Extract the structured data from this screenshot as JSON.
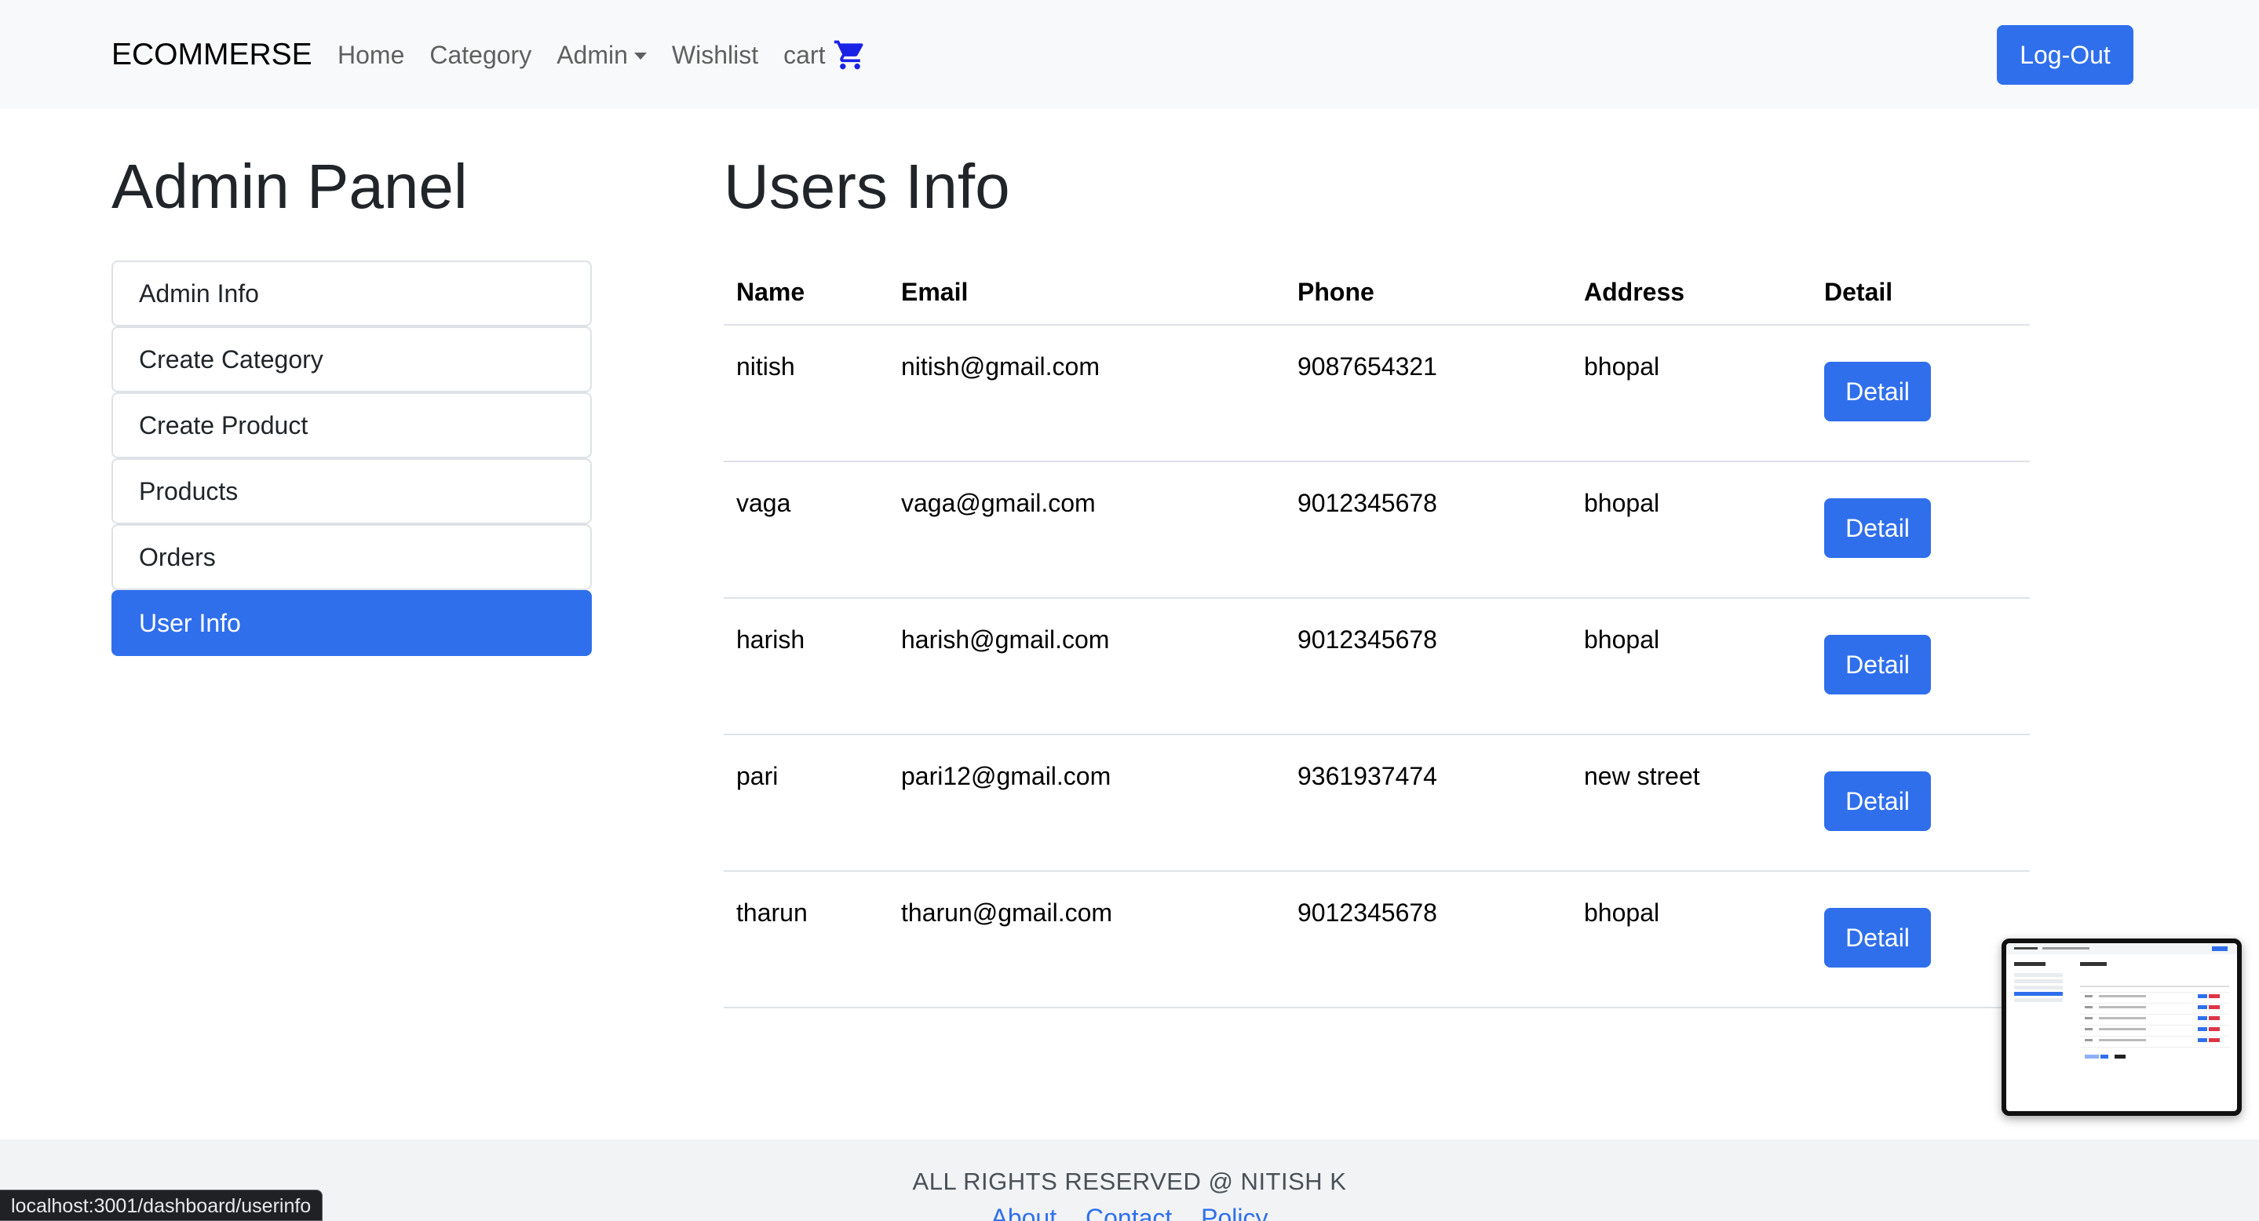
{
  "navbar": {
    "brand": "ECOMMERSE",
    "home": "Home",
    "category": "Category",
    "admin": "Admin",
    "wishlist": "Wishlist",
    "cart": "cart",
    "logout": "Log-Out",
    "accent_color": "#2f6fec"
  },
  "sidebar": {
    "title": "Admin Panel",
    "items": [
      {
        "label": "Admin Info"
      },
      {
        "label": "Create Category"
      },
      {
        "label": "Create Product"
      },
      {
        "label": "Products"
      },
      {
        "label": "Orders"
      },
      {
        "label": "User Info",
        "active": true
      }
    ]
  },
  "main": {
    "title": "Users Info",
    "columns": [
      "Name",
      "Email",
      "Phone",
      "Address",
      "Detail"
    ],
    "rows": [
      {
        "name": "nitish",
        "email": "nitish@gmail.com",
        "phone": "9087654321",
        "address": "bhopal",
        "action": "Detail"
      },
      {
        "name": "vaga",
        "email": "vaga@gmail.com",
        "phone": "9012345678",
        "address": "bhopal",
        "action": "Detail"
      },
      {
        "name": "harish",
        "email": "harish@gmail.com",
        "phone": "9012345678",
        "address": "bhopal",
        "action": "Detail"
      },
      {
        "name": "pari",
        "email": "pari12@gmail.com",
        "phone": "9361937474",
        "address": "new street",
        "action": "Detail"
      },
      {
        "name": "tharun",
        "email": "tharun@gmail.com",
        "phone": "9012345678",
        "address": "bhopal",
        "action": "Detail"
      }
    ]
  },
  "footer": {
    "text": "ALL RIGHTS RESERVED @ NITISH K",
    "links": [
      "About",
      "Contact",
      "Policy"
    ]
  },
  "status_bar": {
    "url": "localhost:3001/dashboard/userinfo"
  },
  "icons": {
    "cart": "shopping-cart-icon",
    "admin_dropdown": "caret-down-icon"
  }
}
